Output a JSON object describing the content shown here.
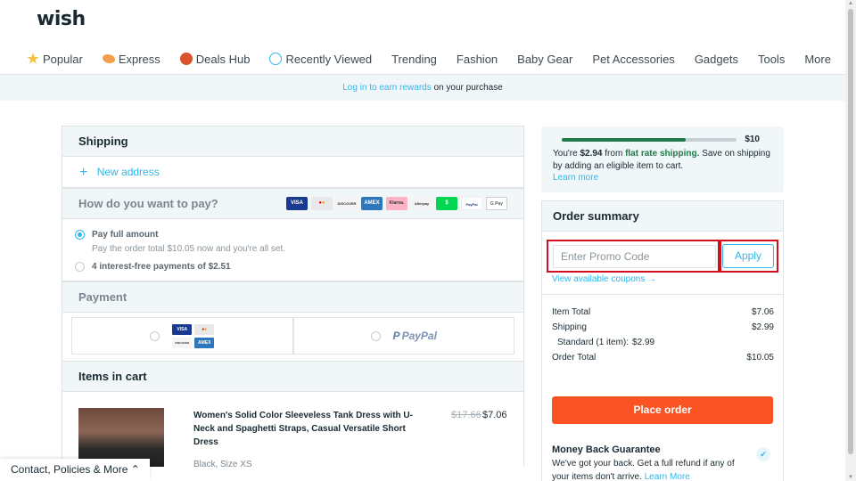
{
  "brand": {
    "logo": "wish"
  },
  "nav": {
    "items": [
      {
        "label": "Popular",
        "icon": "star-icon",
        "color": "#f5c242"
      },
      {
        "label": "Express",
        "icon": "express-icon",
        "color": "#f0a04b"
      },
      {
        "label": "Deals Hub",
        "icon": "deals-icon",
        "color": "#d9532b"
      },
      {
        "label": "Recently Viewed",
        "icon": "clock-icon",
        "color": "#2fb7ec"
      },
      {
        "label": "Trending",
        "icon": ""
      },
      {
        "label": "Fashion",
        "icon": ""
      },
      {
        "label": "Baby Gear",
        "icon": ""
      },
      {
        "label": "Pet Accessories",
        "icon": ""
      },
      {
        "label": "Gadgets",
        "icon": ""
      },
      {
        "label": "Tools",
        "icon": ""
      },
      {
        "label": "More",
        "icon": ""
      }
    ]
  },
  "rewards": {
    "link": "Log in to earn rewards",
    "rest": "on your purchase"
  },
  "shipping": {
    "title": "Shipping",
    "new_address": "New address"
  },
  "pay": {
    "title": "How do you want to pay?",
    "cards": [
      "VISA",
      "MC",
      "DISCOVER",
      "AMEX",
      "Klarna.",
      "Afterpay",
      "$",
      "PayPal",
      "G Pay"
    ],
    "full": {
      "label": "Pay full amount",
      "sub": "Pay the order total $10.05 now and you're all set."
    },
    "installments": {
      "label": "4 interest-free payments of $2.51"
    }
  },
  "payment": {
    "title": "Payment",
    "card_brands": [
      "VISA",
      "MC",
      "DISCOVER",
      "AMEX"
    ],
    "paypal": "PayPal"
  },
  "cart": {
    "title": "Items in cart",
    "item": {
      "title": "Women's Solid Color Sleeveless Tank Dress with U-Neck and Spaghetti Straps, Casual Versatile Short Dress",
      "variant": "Black, Size XS",
      "old_price": "$17.66",
      "price": "$7.06"
    }
  },
  "banner": {
    "goal": "$10",
    "progress": 0.71,
    "prefix": "You're",
    "amount": "$2.94",
    "from": "from",
    "flat": "flat rate shipping.",
    "rest": "Save on shipping by adding an eligible item to cart.",
    "learn_more": "Learn more"
  },
  "summary": {
    "title": "Order summary",
    "promo_placeholder": "Enter Promo Code",
    "apply": "Apply",
    "coupons": "View available coupons →",
    "rows": {
      "item_total_label": "Item Total",
      "item_total": "$7.06",
      "shipping_label": "Shipping",
      "shipping": "$2.99",
      "standard_label": "Standard (1 item):",
      "standard": "$2.99",
      "order_total_label": "Order Total",
      "order_total": "$10.05"
    },
    "place_order": "Place order",
    "mbg": {
      "title": "Money Back Guarantee",
      "text": "We've got your back. Get a full refund if any of your items don't arrive.",
      "link": "Learn More"
    }
  },
  "footer": {
    "label": "Contact, Policies & More ⌃"
  }
}
